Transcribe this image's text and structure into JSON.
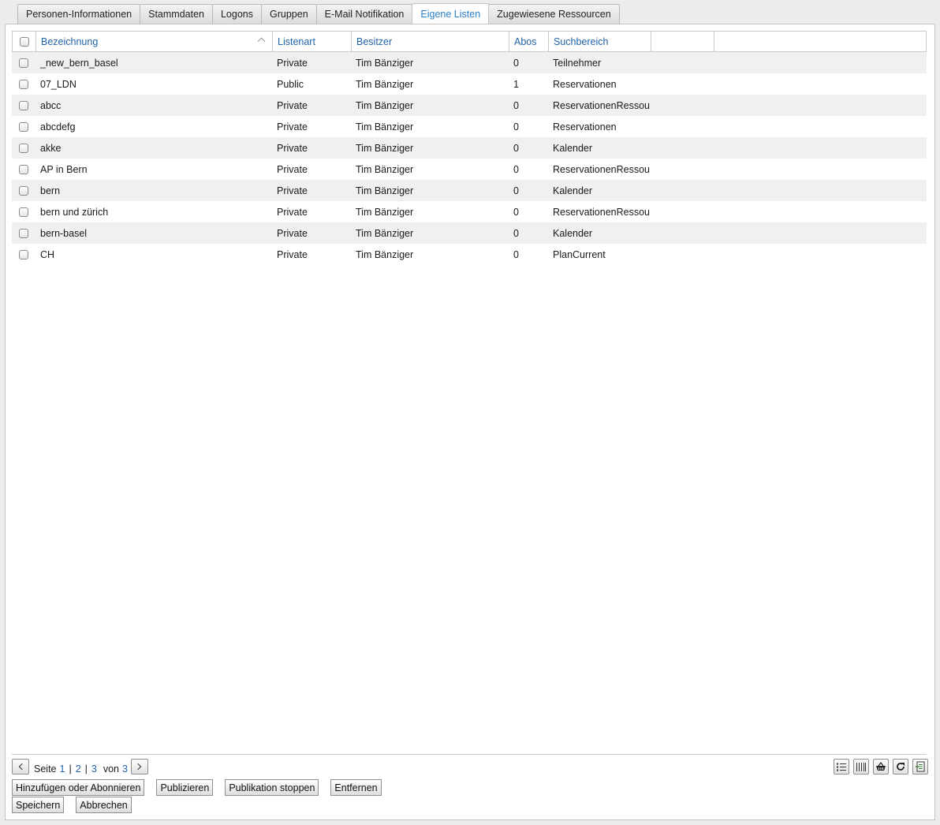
{
  "tabs": [
    {
      "label": "Personen-Informationen",
      "active": false
    },
    {
      "label": "Stammdaten",
      "active": false
    },
    {
      "label": "Logons",
      "active": false
    },
    {
      "label": "Gruppen",
      "active": false
    },
    {
      "label": "E-Mail Notifikation",
      "active": false
    },
    {
      "label": "Eigene Listen",
      "active": true
    },
    {
      "label": "Zugewiesene Ressourcen",
      "active": false
    }
  ],
  "grid": {
    "columns": [
      "Bezeichnung",
      "Listenart",
      "Besitzer",
      "Abos",
      "Suchbereich",
      "",
      ""
    ],
    "sorted_by": "Bezeichnung",
    "rows": [
      [
        "_new_bern_basel",
        "Private",
        "Tim Bänziger",
        "0",
        "Teilnehmer"
      ],
      [
        "07_LDN",
        "Public",
        "Tim Bänziger",
        "1",
        "Reservationen"
      ],
      [
        "abcc",
        "Private",
        "Tim Bänziger",
        "0",
        "ReservationenRessou"
      ],
      [
        "abcdefg",
        "Private",
        "Tim Bänziger",
        "0",
        "Reservationen"
      ],
      [
        "akke",
        "Private",
        "Tim Bänziger",
        "0",
        "Kalender"
      ],
      [
        "AP in Bern",
        "Private",
        "Tim Bänziger",
        "0",
        "ReservationenRessou"
      ],
      [
        "bern",
        "Private",
        "Tim Bänziger",
        "0",
        "Kalender"
      ],
      [
        "bern und zürich",
        "Private",
        "Tim Bänziger",
        "0",
        "ReservationenRessou"
      ],
      [
        "bern-basel",
        "Private",
        "Tim Bänziger",
        "0",
        "Kalender"
      ],
      [
        "CH",
        "Private",
        "Tim Bänziger",
        "0",
        "PlanCurrent"
      ]
    ]
  },
  "pager": {
    "seite_label": "Seite",
    "pages": [
      "1",
      "2",
      "3"
    ],
    "von_label": "von",
    "total": "3",
    "separator": "|"
  },
  "buttons": {
    "add_subscribe": "Hinzufügen oder Abonnieren",
    "publish": "Publizieren",
    "stop_publish": "Publikation stoppen",
    "remove": "Entfernen",
    "save": "Speichern",
    "cancel": "Abbrechen"
  },
  "toolbar_icons": [
    "list-icon",
    "columns-icon",
    "basket-icon",
    "refresh-icon",
    "export-icon"
  ],
  "colors": {
    "link": "#2163a8",
    "active_tab": "#2a7fc7",
    "row_alt": "#f0f0f0"
  }
}
